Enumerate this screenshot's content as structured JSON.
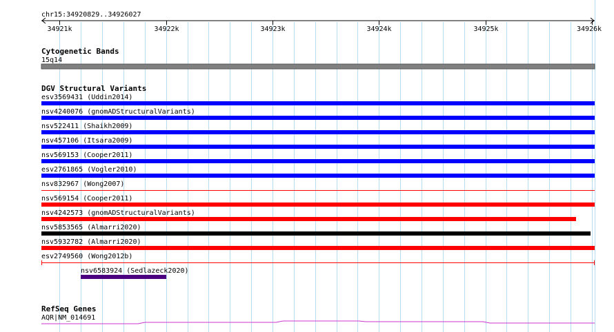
{
  "ruler": {
    "range_label": "chr15:34920829..34926027",
    "start": 34920829,
    "end": 34926027,
    "ticks": [
      {
        "pos": 34921000,
        "label": "34921k"
      },
      {
        "pos": 34922000,
        "label": "34922k"
      },
      {
        "pos": 34923000,
        "label": "34923k"
      },
      {
        "pos": 34924000,
        "label": "34924k"
      },
      {
        "pos": 34925000,
        "label": "34925k"
      },
      {
        "pos": 34926000,
        "label": "34926k"
      }
    ]
  },
  "tracks": {
    "cytoband": {
      "title": "Cytogenetic Bands",
      "band_label": "15q14",
      "color": "#808080"
    },
    "dgv": {
      "title": "DGV Structural Variants",
      "variants": [
        {
          "label": "esv3569431 (Uddin2014)",
          "color": "#0000ff",
          "style": "bar",
          "start": 34920829,
          "end": 34926027
        },
        {
          "label": "nsv4240076 (gnomADStructuralVariants)",
          "color": "#0000ff",
          "style": "bar",
          "start": 34920829,
          "end": 34926027
        },
        {
          "label": "nsv522411 (Shaikh2009)",
          "color": "#0000ff",
          "style": "bar",
          "start": 34920829,
          "end": 34926027
        },
        {
          "label": "nsv457106 (Itsara2009)",
          "color": "#0000ff",
          "style": "bar",
          "start": 34920829,
          "end": 34926027
        },
        {
          "label": "nsv569153 (Cooper2011)",
          "color": "#0000ff",
          "style": "bar",
          "start": 34920829,
          "end": 34926027
        },
        {
          "label": "esv2761865 (Vogler2010)",
          "color": "#0000ff",
          "style": "bar",
          "start": 34920829,
          "end": 34926027
        },
        {
          "label": "nsv832967 (Wong2007)",
          "color": "#ff0000",
          "style": "line",
          "start": 34920829,
          "end": 34926027
        },
        {
          "label": "nsv569154 (Cooper2011)",
          "color": "#ff0000",
          "style": "bar",
          "start": 34920829,
          "end": 34926027
        },
        {
          "label": "nsv4242573 (gnomADStructuralVariants)",
          "color": "#ff0000",
          "style": "bar",
          "start": 34920829,
          "end": 34925850
        },
        {
          "label": "nsv5853565 (Almarri2020)",
          "color": "#000000",
          "style": "bar",
          "start": 34920829,
          "end": 34925990
        },
        {
          "label": "nsv5932782 (Almarri2020)",
          "color": "#ff0000",
          "style": "bar",
          "start": 34920829,
          "end": 34926027
        },
        {
          "label": "esv2749560 (Wong2012b)",
          "color": "#ff0000",
          "style": "bracket",
          "start": 34920829,
          "end": 34926027
        },
        {
          "label": "nsv6583924 (Sedlazeck2020)",
          "color": "#4b0082",
          "style": "bar",
          "start": 34921200,
          "end": 34922000
        }
      ]
    },
    "refseq": {
      "title": "RefSeq Genes",
      "genes": [
        {
          "label": "AQR|NM_014691",
          "color": "#cc33cc"
        }
      ]
    }
  }
}
